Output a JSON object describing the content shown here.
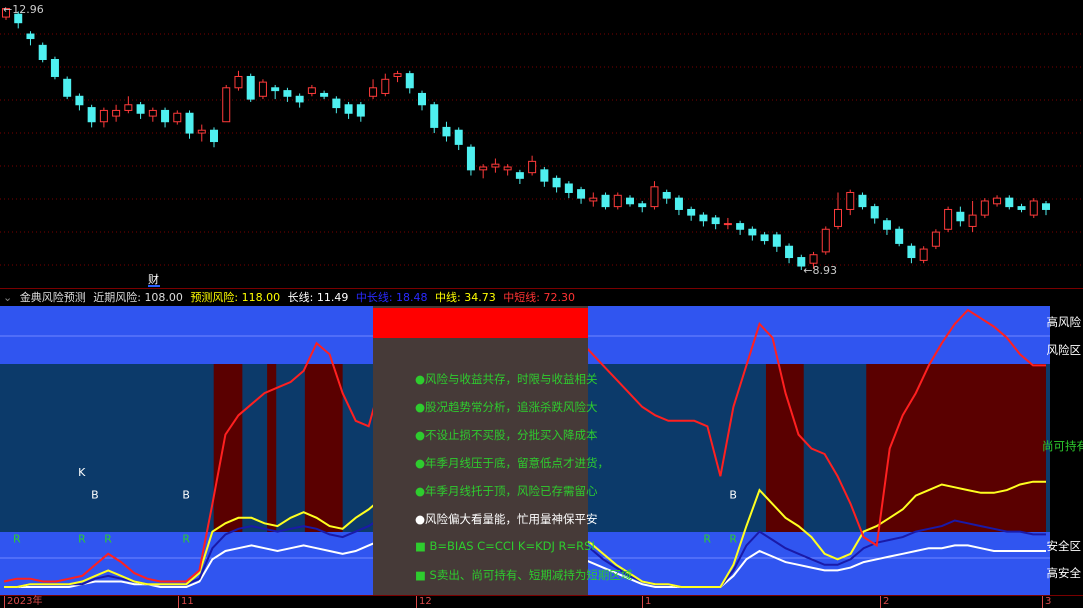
{
  "main": {
    "high_label": "12.96",
    "low_label": "8.93",
    "marker_label": "财",
    "candles": [
      [
        12.8,
        12.95,
        12.96,
        12.75
      ],
      [
        12.85,
        12.7,
        12.9,
        12.6
      ],
      [
        12.5,
        12.42,
        12.55,
        12.3
      ],
      [
        12.3,
        12.05,
        12.35,
        12.0
      ],
      [
        12.05,
        11.75,
        12.1,
        11.7
      ],
      [
        11.7,
        11.4,
        11.75,
        11.35
      ],
      [
        11.4,
        11.25,
        11.45,
        11.15
      ],
      [
        11.2,
        10.95,
        11.25,
        10.85
      ],
      [
        10.95,
        11.15,
        11.2,
        10.85
      ],
      [
        11.05,
        11.15,
        11.25,
        10.95
      ],
      [
        11.15,
        11.25,
        11.4,
        11.1
      ],
      [
        11.25,
        11.1,
        11.3,
        11.0
      ],
      [
        11.05,
        11.15,
        11.2,
        10.95
      ],
      [
        11.15,
        10.95,
        11.2,
        10.85
      ],
      [
        10.95,
        11.1,
        11.15,
        10.9
      ],
      [
        11.1,
        10.75,
        11.15,
        10.65
      ],
      [
        10.75,
        10.8,
        10.9,
        10.6
      ],
      [
        10.8,
        10.6,
        10.85,
        10.5
      ],
      [
        10.95,
        11.55,
        11.6,
        10.95
      ],
      [
        11.55,
        11.75,
        11.85,
        11.5
      ],
      [
        11.75,
        11.35,
        11.8,
        11.3
      ],
      [
        11.4,
        11.65,
        11.7,
        11.35
      ],
      [
        11.55,
        11.5,
        11.6,
        11.35
      ],
      [
        11.5,
        11.4,
        11.55,
        11.3
      ],
      [
        11.4,
        11.3,
        11.45,
        11.2
      ],
      [
        11.45,
        11.55,
        11.6,
        11.4
      ],
      [
        11.45,
        11.4,
        11.5,
        11.35
      ],
      [
        11.35,
        11.2,
        11.4,
        11.1
      ],
      [
        11.25,
        11.1,
        11.3,
        11.0
      ],
      [
        11.25,
        11.05,
        11.3,
        10.95
      ],
      [
        11.4,
        11.55,
        11.7,
        11.35
      ],
      [
        11.45,
        11.7,
        11.8,
        11.4
      ],
      [
        11.75,
        11.8,
        11.85,
        11.65
      ],
      [
        11.8,
        11.55,
        11.85,
        11.45
      ],
      [
        11.45,
        11.25,
        11.5,
        11.15
      ],
      [
        11.25,
        10.85,
        11.3,
        10.75
      ],
      [
        10.85,
        10.7,
        10.95,
        10.6
      ],
      [
        10.8,
        10.55,
        10.85,
        10.45
      ],
      [
        10.5,
        10.1,
        10.55,
        10.0
      ],
      [
        10.1,
        10.15,
        10.2,
        9.95
      ],
      [
        10.15,
        10.2,
        10.3,
        10.05
      ],
      [
        10.1,
        10.15,
        10.2,
        10.0
      ],
      [
        10.05,
        9.95,
        10.1,
        9.85
      ],
      [
        10.05,
        10.25,
        10.35,
        10.0
      ],
      [
        10.1,
        9.9,
        10.15,
        9.8
      ],
      [
        9.95,
        9.8,
        10.0,
        9.7
      ],
      [
        9.85,
        9.7,
        9.9,
        9.6
      ],
      [
        9.75,
        9.6,
        9.8,
        9.5
      ],
      [
        9.55,
        9.6,
        9.7,
        9.45
      ],
      [
        9.65,
        9.45,
        9.7,
        9.4
      ],
      [
        9.45,
        9.65,
        9.7,
        9.4
      ],
      [
        9.6,
        9.5,
        9.65,
        9.45
      ],
      [
        9.5,
        9.45,
        9.55,
        9.35
      ],
      [
        9.45,
        9.8,
        9.9,
        9.4
      ],
      [
        9.7,
        9.6,
        9.75,
        9.5
      ],
      [
        9.6,
        9.4,
        9.65,
        9.3
      ],
      [
        9.4,
        9.3,
        9.45,
        9.2
      ],
      [
        9.3,
        9.2,
        9.35,
        9.1
      ],
      [
        9.25,
        9.15,
        9.3,
        9.05
      ],
      [
        9.15,
        9.15,
        9.25,
        9.05
      ],
      [
        9.15,
        9.05,
        9.2,
        8.95
      ],
      [
        9.05,
        8.95,
        9.1,
        8.85
      ],
      [
        8.95,
        8.85,
        9.0,
        8.78
      ],
      [
        8.95,
        8.75,
        9.0,
        8.65
      ],
      [
        8.75,
        8.55,
        8.8,
        8.45
      ],
      [
        8.55,
        8.4,
        8.6,
        8.33
      ],
      [
        8.45,
        8.6,
        8.65,
        8.35
      ],
      [
        8.65,
        9.05,
        9.1,
        8.6
      ],
      [
        9.1,
        9.4,
        9.7,
        9.05
      ],
      [
        9.4,
        9.7,
        9.75,
        9.3
      ],
      [
        9.65,
        9.45,
        9.7,
        9.4
      ],
      [
        9.45,
        9.25,
        9.5,
        9.15
      ],
      [
        9.2,
        9.05,
        9.25,
        8.95
      ],
      [
        9.05,
        8.8,
        9.1,
        8.75
      ],
      [
        8.75,
        8.55,
        8.8,
        8.45
      ],
      [
        8.5,
        8.7,
        8.75,
        8.45
      ],
      [
        8.75,
        9.0,
        9.05,
        8.7
      ],
      [
        9.05,
        9.4,
        9.45,
        9.0
      ],
      [
        9.35,
        9.2,
        9.45,
        9.1
      ],
      [
        9.1,
        9.3,
        9.55,
        9.0
      ],
      [
        9.3,
        9.55,
        9.6,
        9.25
      ],
      [
        9.5,
        9.6,
        9.65,
        9.45
      ],
      [
        9.6,
        9.45,
        9.65,
        9.4
      ],
      [
        9.45,
        9.4,
        9.5,
        9.35
      ],
      [
        9.3,
        9.55,
        9.6,
        9.25
      ],
      [
        9.5,
        9.4,
        9.55,
        9.3
      ]
    ]
  },
  "info_bar": {
    "title": "金典风险预测",
    "recent_risk_label": "近期风险:",
    "recent_risk_value": "108.00",
    "forecast_risk": "预测风险: 118.00",
    "long_line": "长线: 11.49",
    "mid_long_line": "中长线: 18.48",
    "mid_line": "中线: 34.73",
    "mid_short_line": "中短线: 72.30"
  },
  "indicator": {
    "zones": [
      "高风险",
      "风险区",
      "尚可持有",
      "安全区",
      "高安全"
    ],
    "tips": [
      "●风险与收益共存，时限与收益相关",
      "●股况趋势常分析，追涨杀跌风险大",
      "●不设止损不买股，分批买入降成本",
      "●年季月线压于底，留意低点才进货，",
      "●年季月线托于顶，风险已存需留心",
      "●风险偏大看量能，忙用量神保平安",
      "■ B=BIAS C=CCI K=KDJ R=RSI",
      "■ S卖出、尚可持有、短期减持为短期区域"
    ],
    "signals": [
      {
        "i": 1,
        "text": "R",
        "color": "#2ecc2e",
        "level": 16
      },
      {
        "i": 6,
        "text": "K",
        "color": "#ffffff",
        "level": 40
      },
      {
        "i": 7,
        "text": "B",
        "color": "#ffffff",
        "level": 32
      },
      {
        "i": 6,
        "text": "R",
        "color": "#2ecc2e",
        "level": 16
      },
      {
        "i": 8,
        "text": "R",
        "color": "#2ecc2e",
        "level": 16
      },
      {
        "i": 14,
        "text": "B",
        "color": "#ffffff",
        "level": 32
      },
      {
        "i": 14,
        "text": "R",
        "color": "#2ecc2e",
        "level": 16
      },
      {
        "i": 56,
        "text": "B",
        "color": "#ffffff",
        "level": 32
      },
      {
        "i": 54,
        "text": "R",
        "color": "#2ecc2e",
        "level": 16
      },
      {
        "i": 56,
        "text": "R",
        "color": "#2ecc2e",
        "level": 16
      }
    ],
    "red_line": [
      2,
      3,
      3,
      2,
      2,
      3,
      4,
      8,
      12,
      9,
      5,
      3,
      2,
      2,
      2,
      6,
      30,
      55,
      62,
      66,
      70,
      72,
      74,
      78,
      88,
      84,
      70,
      60,
      58,
      75,
      88,
      96,
      97,
      92,
      88,
      86,
      84,
      84,
      84,
      84,
      84,
      84,
      84,
      84,
      90,
      85,
      80,
      75,
      70,
      65,
      62,
      60,
      60,
      60,
      58,
      40,
      65,
      80,
      95,
      90,
      70,
      55,
      50,
      48,
      40,
      30,
      18,
      15,
      50,
      62,
      70,
      80,
      88,
      95,
      100,
      97,
      94,
      90,
      84,
      80,
      80
    ],
    "yellow_line": [
      0,
      0,
      1,
      1,
      1,
      1,
      2,
      4,
      6,
      4,
      2,
      1,
      1,
      1,
      1,
      5,
      20,
      23,
      25,
      25,
      23,
      22,
      25,
      27,
      25,
      22,
      21,
      25,
      28,
      32,
      25,
      20,
      20,
      20,
      20,
      20,
      20,
      20,
      20,
      20,
      20,
      20,
      20,
      20,
      18,
      16,
      12,
      8,
      5,
      2,
      1,
      1,
      0,
      0,
      0,
      0,
      8,
      22,
      35,
      30,
      25,
      22,
      18,
      12,
      10,
      12,
      20,
      22,
      25,
      28,
      33,
      35,
      37,
      36,
      35,
      34,
      34,
      35,
      37,
      38,
      38
    ],
    "blue_line": [
      0,
      0,
      1,
      1,
      1,
      1,
      1,
      3,
      4,
      3,
      2,
      1,
      1,
      1,
      1,
      3,
      14,
      19,
      21,
      22,
      21,
      20,
      21,
      22,
      21,
      19,
      18,
      20,
      22,
      25,
      21,
      18,
      18,
      18,
      18,
      18,
      18,
      18,
      18,
      18,
      18,
      18,
      18,
      18,
      16,
      14,
      10,
      7,
      4,
      2,
      1,
      1,
      0,
      0,
      0,
      0,
      6,
      15,
      20,
      17,
      14,
      12,
      10,
      8,
      8,
      10,
      14,
      16,
      17,
      18,
      20,
      21,
      22,
      24,
      23,
      22,
      21,
      20,
      20,
      19,
      19
    ],
    "white_line": [
      0,
      0,
      0,
      0,
      0,
      0,
      1,
      2,
      2,
      2,
      1,
      1,
      0,
      0,
      0,
      2,
      10,
      13,
      14,
      15,
      14,
      13,
      14,
      15,
      14,
      13,
      12,
      13,
      15,
      17,
      15,
      13,
      13,
      13,
      13,
      13,
      13,
      13,
      13,
      13,
      13,
      13,
      13,
      13,
      11,
      9,
      7,
      5,
      3,
      1,
      0,
      0,
      0,
      0,
      0,
      0,
      4,
      10,
      13,
      11,
      9,
      8,
      7,
      6,
      6,
      7,
      9,
      10,
      11,
      12,
      13,
      14,
      14,
      15,
      15,
      14,
      13,
      13,
      13,
      13,
      13
    ]
  },
  "axis": {
    "labels": [
      "2023年",
      "11",
      "12",
      "1",
      "2",
      "3"
    ]
  },
  "colors": {
    "up": "#ff3b3b",
    "down": "#4ff0f0",
    "risk_band": "#3055f0",
    "dark_band": "#0c3a6a",
    "maroon": "#5a0000",
    "overlay": "#463a38",
    "red_block": "#ff0000"
  }
}
